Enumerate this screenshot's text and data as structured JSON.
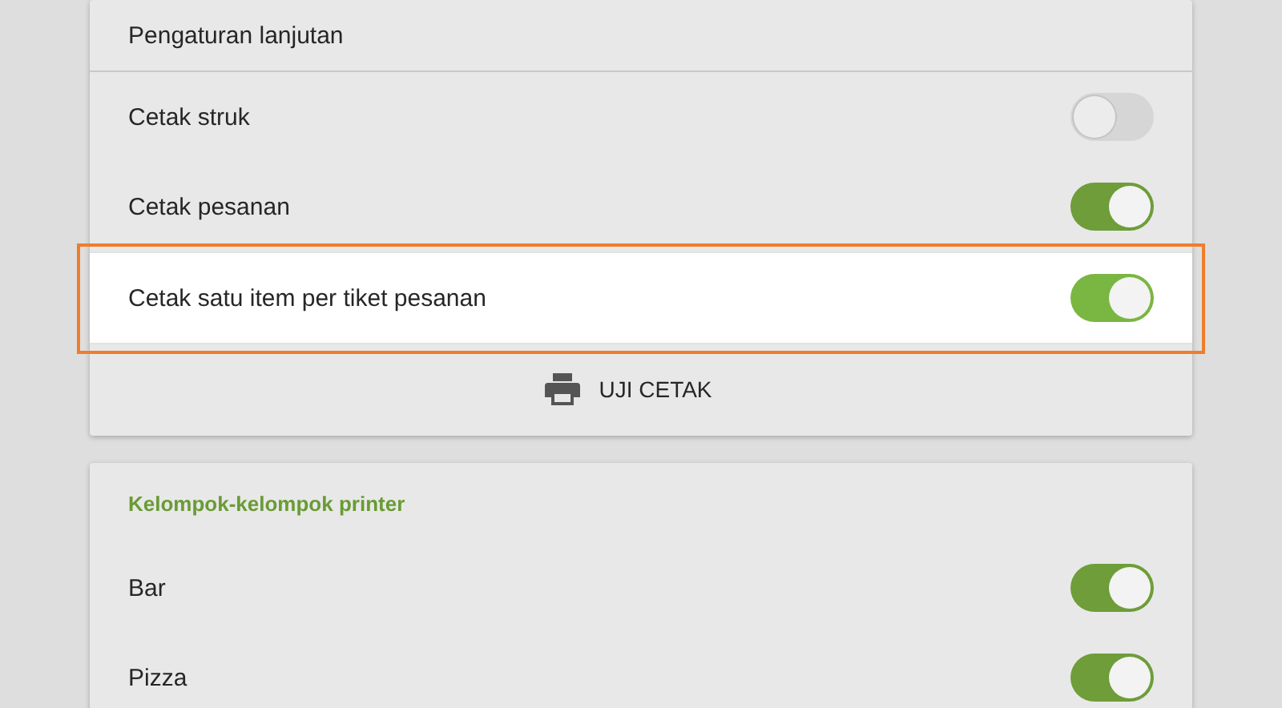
{
  "advanced_card": {
    "title": "Pengaturan lanjutan",
    "settings": [
      {
        "label": "Cetak struk",
        "on": false,
        "highlighted": false
      },
      {
        "label": "Cetak pesanan",
        "on": true,
        "highlighted": false
      },
      {
        "label": "Cetak satu item per tiket pesanan",
        "on": true,
        "highlighted": true
      }
    ],
    "button": "UJI CETAK"
  },
  "groups_card": {
    "title": "Kelompok-kelompok printer",
    "groups": [
      {
        "label": "Bar",
        "on": true
      },
      {
        "label": "Pizza",
        "on": true
      }
    ]
  }
}
